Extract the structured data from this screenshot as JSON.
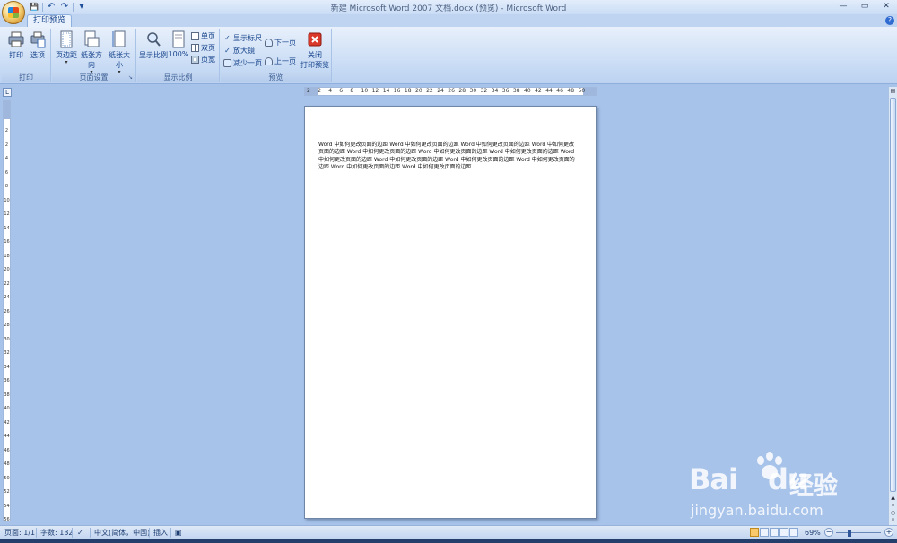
{
  "window": {
    "title": "新建 Microsoft Word 2007 文档.docx (预览) - Microsoft Word",
    "controls": [
      "—",
      "▭",
      "✕"
    ]
  },
  "qat": {
    "save": "💾",
    "undo": "↶",
    "redo": "↷",
    "more": "▾"
  },
  "tab": {
    "label": "打印预览"
  },
  "ribbon": {
    "print_group": {
      "label": "打印",
      "print": "打印",
      "options": "选项"
    },
    "page_setup_group": {
      "label": "页面设置",
      "margins": "页边距",
      "orientation": "纸张方向",
      "size": "纸张大小"
    },
    "zoom_group": {
      "label": "显示比例",
      "zoom": "显示比例",
      "zoom100": "100%",
      "one_page": "单页",
      "two_pages": "双页",
      "page_width": "页宽"
    },
    "preview_group": {
      "label": "预览",
      "show_ruler": "显示标尺",
      "magnifier": "放大镜",
      "shrink": "减少一页",
      "next_page": "下一页",
      "prev_page": "上一页",
      "close_line1": "关闭",
      "close_line2": "打印预览"
    }
  },
  "ruler": {
    "horizontal": [
      "2",
      "2",
      "4",
      "6",
      "8",
      "10",
      "12",
      "14",
      "16",
      "18",
      "20",
      "22",
      "24",
      "26",
      "28",
      "30",
      "32",
      "34",
      "36",
      "38",
      "40",
      "42",
      "44",
      "46",
      "48",
      "50"
    ],
    "vertical": [
      "2",
      "2",
      "4",
      "6",
      "8",
      "10",
      "12",
      "14",
      "16",
      "18",
      "20",
      "22",
      "24",
      "26",
      "28",
      "30",
      "32",
      "34",
      "36",
      "38",
      "40",
      "42",
      "44",
      "46",
      "48",
      "50",
      "52",
      "54",
      "56"
    ],
    "corner": "L"
  },
  "document": {
    "text": "Word 中如何更改页面的边距 Word 中如何更改页面的边距 Word 中如何更改页面的边距 Word 中如何更改页面的边距 Word 中如何更改页面的边距 Word 中如何更改页面的边距 Word 中如何更改页面的边距 Word 中如何更改页面的边距 Word 中如何更改页面的边距 Word 中如何更改页面的边距 Word 中如何更改页面的边距 Word 中如何更改页面的边距 Word 中如何更改页面的边距"
  },
  "status": {
    "page": "页面: 1/1",
    "words": "字数: 132",
    "language": "中文(简体，中国)",
    "mode": "插入",
    "zoom": "69%",
    "zoom_minus": "−",
    "zoom_plus": "+"
  },
  "watermark": {
    "brand": "Bai",
    "brand2": "du",
    "cn": "经验",
    "url": "jingyan.baidu.com"
  },
  "colors": {
    "ribbon_text": "#15428b",
    "background": "#a7c3ea",
    "close_red": "#d9382b"
  }
}
